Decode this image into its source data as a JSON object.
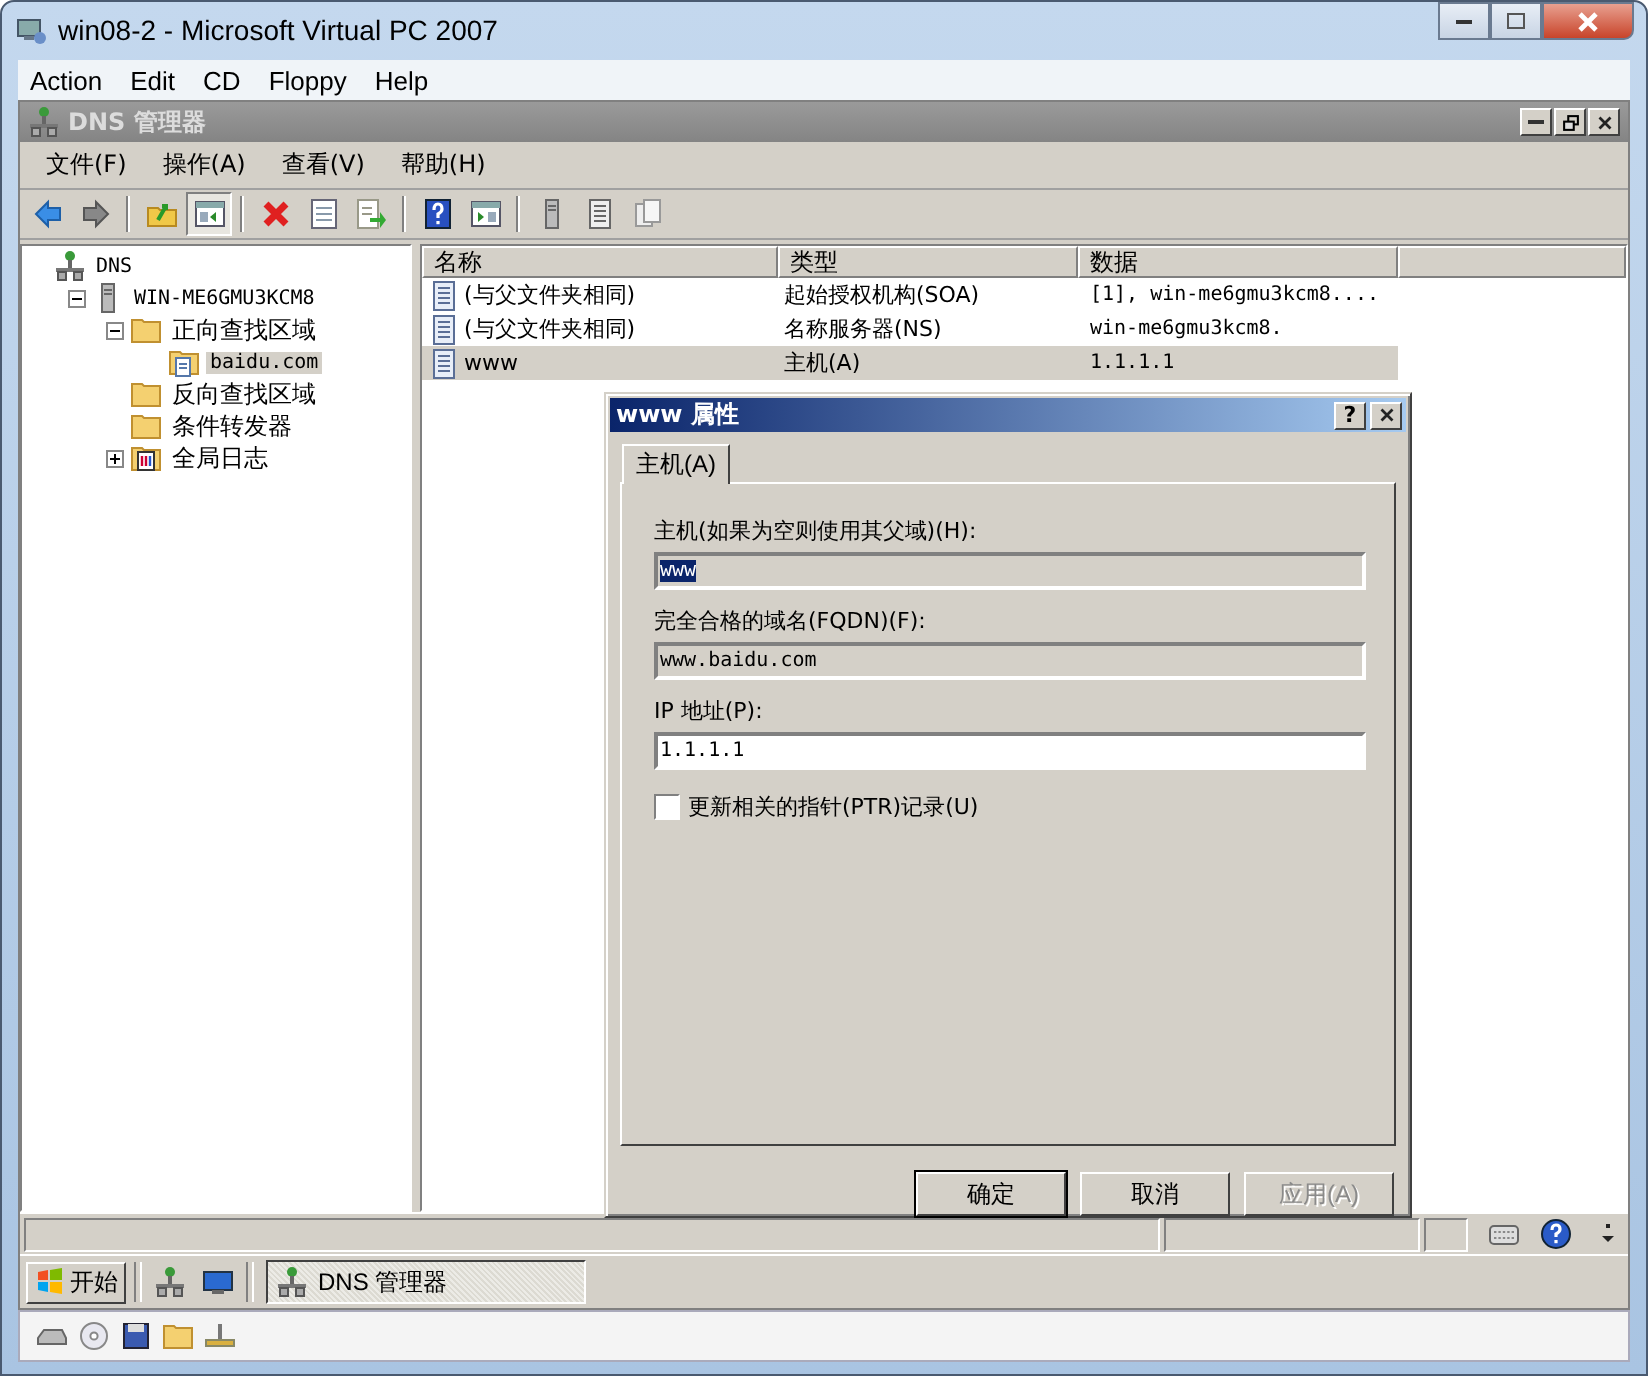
{
  "window": {
    "title": "win08-2 - Microsoft Virtual PC 2007"
  },
  "vpc_menu": [
    "Action",
    "Edit",
    "CD",
    "Floppy",
    "Help"
  ],
  "mmc": {
    "title": "DNS 管理器",
    "menu": [
      "文件(F)",
      "操作(A)",
      "查看(V)",
      "帮助(H)"
    ],
    "toolbar": [
      {
        "kind": "back",
        "pressed": false
      },
      {
        "kind": "forward",
        "pressed": false
      },
      {
        "kind": "separator"
      },
      {
        "kind": "up",
        "pressed": false
      },
      {
        "kind": "tree",
        "pressed": true
      },
      {
        "kind": "separator"
      },
      {
        "kind": "delete",
        "pressed": false
      },
      {
        "kind": "properties",
        "pressed": false
      },
      {
        "kind": "export",
        "pressed": false
      },
      {
        "kind": "separator"
      },
      {
        "kind": "help",
        "pressed": false
      },
      {
        "kind": "pane",
        "pressed": false
      },
      {
        "kind": "separator"
      },
      {
        "kind": "server",
        "pressed": false
      },
      {
        "kind": "list",
        "pressed": false
      },
      {
        "kind": "copy",
        "pressed": false
      }
    ],
    "tree": [
      {
        "label": "DNS",
        "kind": "dns",
        "selected": false,
        "children": [
          {
            "label": "WIN-ME6GMU3KCM8",
            "kind": "server",
            "expanded": true,
            "selected": false,
            "children": [
              {
                "label": "正向查找区域",
                "kind": "folder",
                "expanded": true,
                "selected": false,
                "children": [
                  {
                    "label": "baidu.com",
                    "kind": "zone",
                    "selected": true
                  }
                ]
              },
              {
                "label": "反向查找区域",
                "kind": "folder",
                "selected": false
              },
              {
                "label": "条件转发器",
                "kind": "folder",
                "selected": false
              },
              {
                "label": "全局日志",
                "kind": "log",
                "expanded": false,
                "selected": false
              }
            ]
          }
        ]
      }
    ],
    "columns": [
      "名称",
      "类型",
      "数据"
    ],
    "rows": [
      {
        "name": "(与父文件夹相同)",
        "type": "起始授权机构(SOA)",
        "data": "[1], win-me6gmu3kcm8....",
        "selected": false
      },
      {
        "name": "(与父文件夹相同)",
        "type": "名称服务器(NS)",
        "data": "win-me6gmu3kcm8.",
        "selected": false
      },
      {
        "name": "www",
        "type": "主机(A)",
        "data": "1.1.1.1",
        "selected": true
      }
    ]
  },
  "dialog": {
    "title": "www 属性",
    "help": "?",
    "tabs": [
      {
        "label": "主机(A)",
        "selected": true
      }
    ],
    "fields": [
      {
        "label": "主机(如果为空则使用其父域)(H):",
        "value": "www",
        "readonly": true,
        "highlighted": true
      },
      {
        "label": "完全合格的域名(FQDN)(F):",
        "value": "www.baidu.com",
        "readonly": true,
        "highlighted": false
      },
      {
        "label": "IP 地址(P):",
        "value": "1.1.1.1",
        "readonly": false,
        "highlighted": false
      }
    ],
    "checkbox": {
      "label": "更新相关的指针(PTR)记录(U)",
      "checked": false
    },
    "buttons": [
      {
        "label": "确定",
        "default": true,
        "disabled": false
      },
      {
        "label": "取消",
        "default": false,
        "disabled": false
      },
      {
        "label": "应用(A)",
        "default": false,
        "disabled": true
      }
    ]
  },
  "taskbar": {
    "start": "开始",
    "tasks": [
      {
        "label": "DNS 管理器",
        "active": true
      }
    ]
  }
}
